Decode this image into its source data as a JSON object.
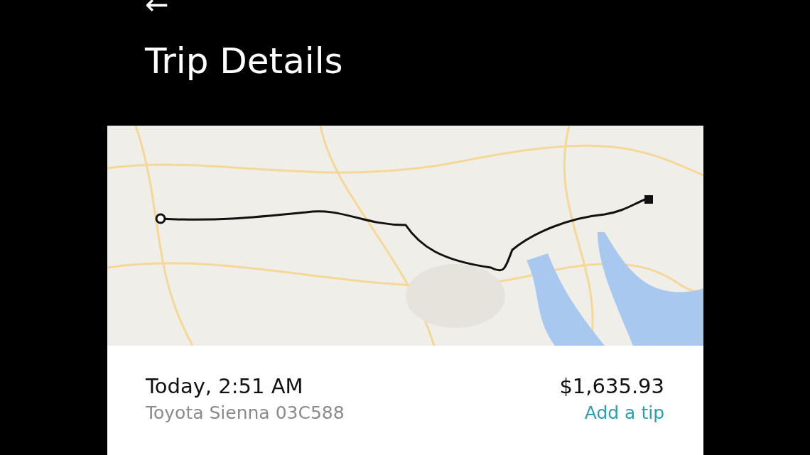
{
  "header": {
    "back": "←",
    "title": "Trip Details"
  },
  "trip": {
    "time": "Today, 2:51 AM",
    "vehicle": "Toyota Sienna 03C588",
    "fare": "$1,635.93",
    "tip_link": "Add a tip"
  }
}
